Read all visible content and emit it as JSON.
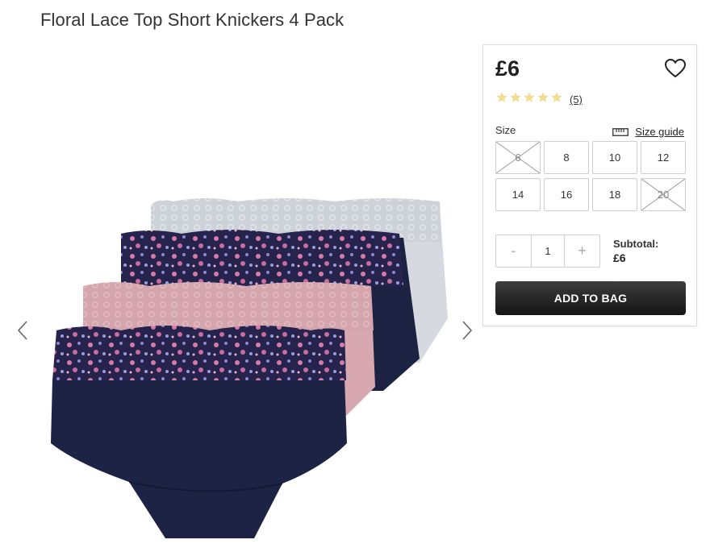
{
  "product": {
    "title": "Floral Lace Top Short Knickers 4 Pack"
  },
  "gallery": {
    "prev_icon": "chevron-left-icon",
    "next_icon": "chevron-right-icon"
  },
  "buybox": {
    "price": "£6",
    "wishlist_icon": "heart-icon",
    "rating": {
      "stars": 5,
      "max": 5,
      "count_label": "(5)",
      "star_color": "#f3dc8e"
    },
    "size": {
      "label": "Size",
      "guide_label": "Size guide",
      "guide_icon": "ruler-icon",
      "options": [
        {
          "label": "6",
          "available": false
        },
        {
          "label": "8",
          "available": true
        },
        {
          "label": "10",
          "available": true
        },
        {
          "label": "12",
          "available": true
        },
        {
          "label": "14",
          "available": true
        },
        {
          "label": "16",
          "available": true
        },
        {
          "label": "18",
          "available": true
        },
        {
          "label": "20",
          "available": false
        }
      ]
    },
    "quantity": {
      "minus": "-",
      "value": "1",
      "plus": "+"
    },
    "subtotal": {
      "label": "Subtotal:",
      "value": "£6"
    },
    "add_to_bag": "ADD TO BAG"
  },
  "colors": {
    "button_dark": "#222222",
    "navy": "#1f2444",
    "pink": "#d7a9b0",
    "grey": "#d4d7dc"
  }
}
